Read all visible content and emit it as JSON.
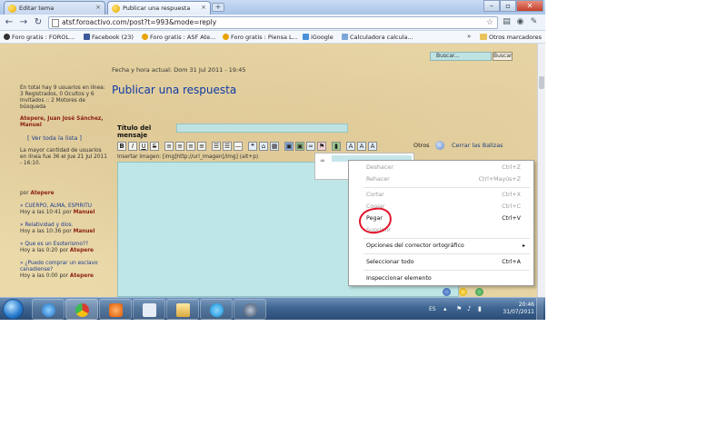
{
  "browser": {
    "tabs": [
      {
        "label": "Editar tema",
        "active": false
      },
      {
        "label": "Publicar una respuesta",
        "active": true
      }
    ],
    "url": "atsf.foroactivo.com/post?t=993&mode=reply",
    "bookmarks": [
      "Foro gratis : FOROL...",
      "Facebook (23)",
      "Foro gratis : ASF Ate...",
      "Foro gratis : Piensa L...",
      "iGoogle",
      "Calculadora calcula..."
    ],
    "bookmarks_more": "»",
    "other_bookmarks": "Otros marcadores"
  },
  "header": {
    "search_placeholder": "Buscar...",
    "search_button": "Buscar"
  },
  "sidebar": {
    "online_text": "En total hay 9 usuarios en línea: 3 Registrados, 0 Ocultos y 6 Invitados :: 2 Motores de búsqueda",
    "online_users": "Atepere, Juan José Sánchez, Manuel",
    "view_all": "[ Ver toda la lista ]",
    "record_text": "La mayor cantidad de usuarios en línea fue 36 el Jue 21 Jul 2011 - 16:10.",
    "by_label": "por",
    "by_user": "Atepere",
    "recent": [
      {
        "title": "» CUERPO, ALMA, ESPIRITU",
        "meta": "Hoy a las 10:41 por",
        "user": "Manuel"
      },
      {
        "title": "» Relatividad y dios.",
        "meta": "Hoy a las 10:36 por",
        "user": "Manuel"
      },
      {
        "title": "» Que es un Esoterismo??",
        "meta": "Hoy a las 0:20 por",
        "user": "Atepere"
      },
      {
        "title": "» ¿Puedo comprar un esclavo canadiense?",
        "meta": "Hoy a las 0:00 por",
        "user": "Atepere"
      }
    ]
  },
  "main": {
    "current_time": "Fecha y hora actual: Dom 31 Jul 2011 - 19:45",
    "heading": "Publicar una respuesta",
    "title_label": "Título del mensaje",
    "editor_buttons": [
      "B",
      "I",
      "U",
      "S"
    ],
    "other_label": "Otros",
    "close_tags": "Cerrar las Balizas",
    "insert_image": "Insertar imagen: [img]http://url_imagen[/img] (alt+p)"
  },
  "context_menu": {
    "items": [
      {
        "label": "Deshacer",
        "shortcut": "Ctrl+Z",
        "disabled": true
      },
      {
        "label": "Rehacer",
        "shortcut": "Ctrl+Mayús+Z",
        "disabled": true
      },
      {
        "label": "Cortar",
        "shortcut": "Ctrl+X",
        "disabled": true
      },
      {
        "label": "Copiar",
        "shortcut": "Ctrl+C",
        "disabled": true
      },
      {
        "label": "Pegar",
        "shortcut": "Ctrl+V",
        "disabled": false
      },
      {
        "label": "Suprimir",
        "shortcut": "",
        "disabled": true
      },
      {
        "label": "Opciones del corrector ortográfico",
        "shortcut": "",
        "disabled": false
      },
      {
        "label": "Seleccionar todo",
        "shortcut": "Ctrl+A",
        "disabled": false
      },
      {
        "label": "Inspeccionar elemento",
        "shortcut": "",
        "disabled": false
      }
    ],
    "highlight_color": "#e3132a"
  },
  "taskbar": {
    "language": "ES",
    "time": "20:46",
    "date": "31/07/2011"
  }
}
